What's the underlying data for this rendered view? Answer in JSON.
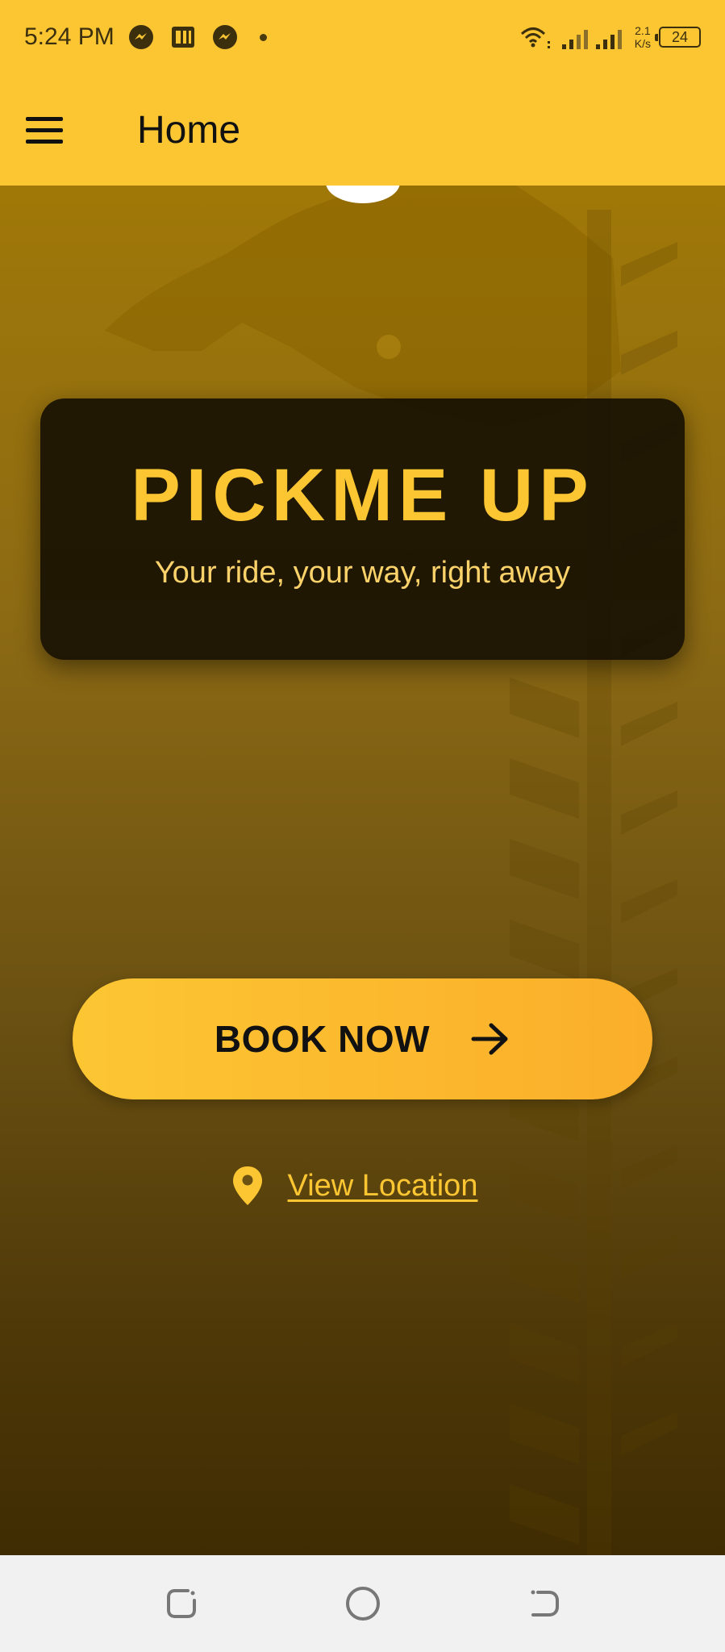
{
  "status_bar": {
    "time": "5:24 PM",
    "net_speed_value": "2.1",
    "net_speed_unit": "K/s",
    "battery": "24"
  },
  "app_bar": {
    "title": "Home",
    "menu_icon": "hamburger-menu-icon"
  },
  "hero": {
    "brand_title": "PICKME UP",
    "tagline": "Your ride, your way, right away"
  },
  "actions": {
    "book_label": "BOOK NOW",
    "book_icon": "arrow-right-icon",
    "location_label": "View Location",
    "location_icon": "location-pin-icon"
  },
  "colors": {
    "accent": "#FCC633",
    "accent_orange": "#FBAE2A",
    "card_bg": "#140E02",
    "nav_bg": "#F1F1F1"
  }
}
